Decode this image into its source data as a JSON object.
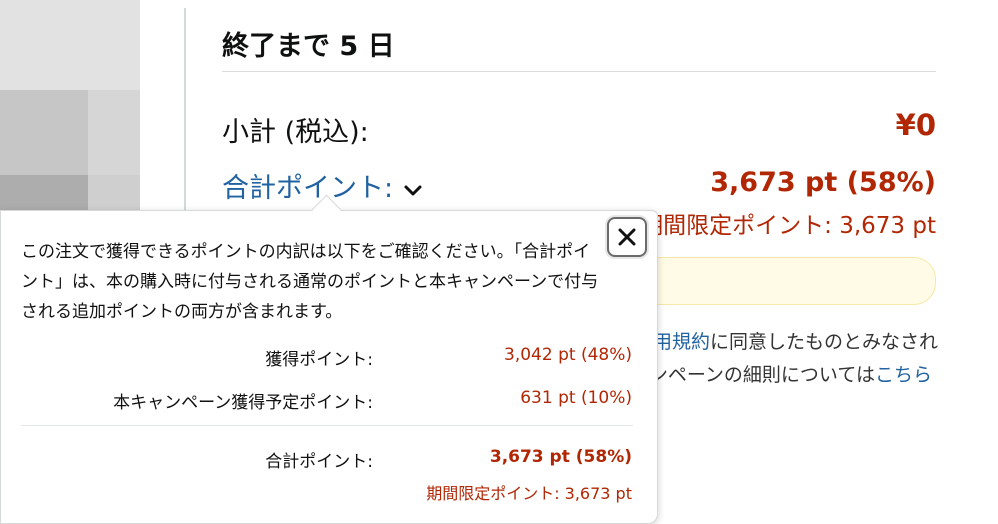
{
  "header": {
    "days_left": "終了まで 5 日"
  },
  "summary": {
    "subtotal_label": "小計 (税込):",
    "subtotal_value": "¥0",
    "points_label": "合計ポイント:",
    "points_value": "3,673 pt (58%)",
    "limited_points": "期間限定ポイント: 3,673 pt"
  },
  "terms": {
    "line1_link": "用規約",
    "line1_rest": "に同意したものとみなされ",
    "line2_text": "ンペーンの細則については",
    "line2_link": "こちら"
  },
  "popover": {
    "description": "この注文で獲得できるポイントの内訳は以下をご確認ください。「合計ポイント」は、本の購入時に付与される通常のポイントと本キャンペーンで付与される追加ポイントの両方が含まれます。",
    "rows": [
      {
        "label": "獲得ポイント:",
        "value": "3,042 pt (48%)"
      },
      {
        "label": "本キャンペーン獲得予定ポイント:",
        "value": "631 pt (10%)"
      }
    ],
    "total_label": "合計ポイント:",
    "total_value": "3,673 pt (58%)",
    "total_limited": "期間限定ポイント: 3,673 pt",
    "close_icon": "close-icon"
  },
  "colors": {
    "price_red": "#b12704",
    "link_blue": "#2162a1",
    "highlight_yellow": "#fffbe6"
  }
}
